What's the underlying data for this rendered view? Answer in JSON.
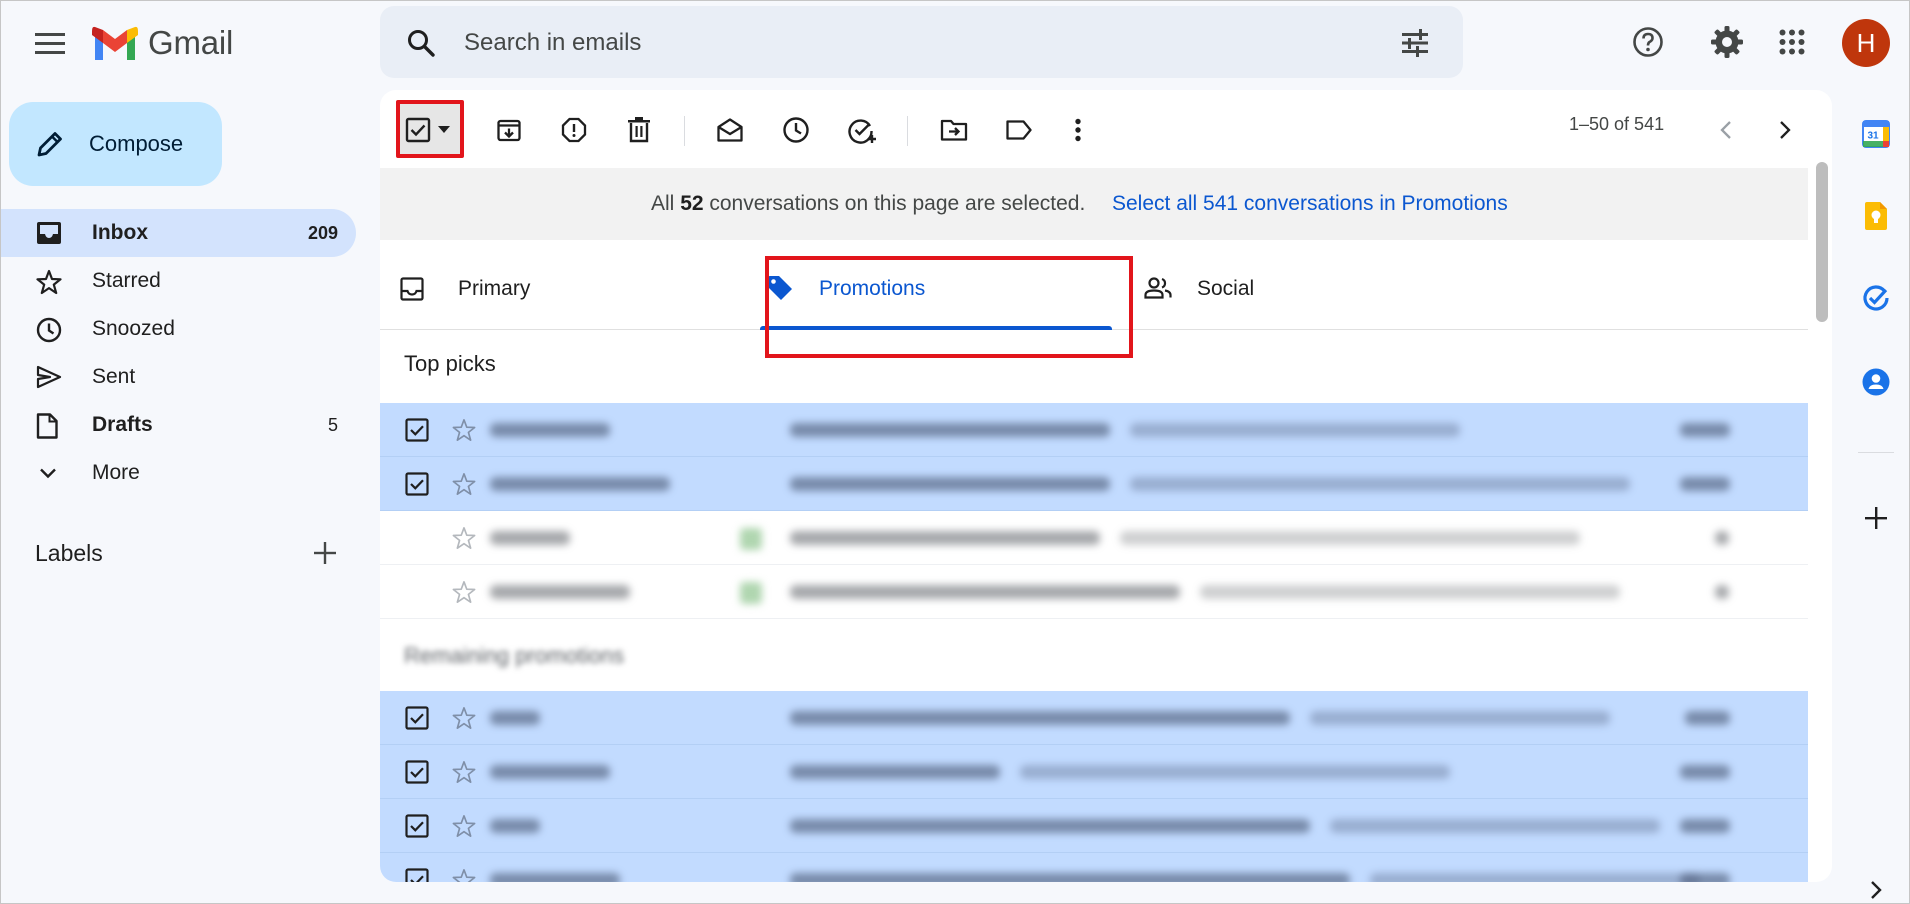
{
  "header": {
    "app_name": "Gmail",
    "search_placeholder": "Search in emails",
    "avatar_initial": "H"
  },
  "nav": {
    "compose_label": "Compose",
    "items": [
      {
        "label": "Inbox",
        "count": "209"
      },
      {
        "label": "Starred",
        "count": ""
      },
      {
        "label": "Snoozed",
        "count": ""
      },
      {
        "label": "Sent",
        "count": ""
      },
      {
        "label": "Drafts",
        "count": "5"
      },
      {
        "label": "More",
        "count": ""
      }
    ],
    "labels_heading": "Labels"
  },
  "toolbar": {
    "pagination": "1–50 of 541"
  },
  "banner": {
    "prefix": "All ",
    "count": "52",
    "suffix": " conversations on this page are selected.",
    "select_all_link": "Select all 541 conversations in Promotions"
  },
  "tabs": [
    {
      "label": "Primary",
      "icon": "inbox-icon"
    },
    {
      "label": "Promotions",
      "icon": "tag-icon"
    },
    {
      "label": "Social",
      "icon": "people-icon"
    }
  ],
  "sections": {
    "top_picks": "Top picks",
    "remaining": "Remaining promotions"
  },
  "colors": {
    "accent": "#0b57d0",
    "highlight_box": "#e2151b",
    "selected_row": "#c2dbff",
    "avatar": "#bf360c"
  }
}
